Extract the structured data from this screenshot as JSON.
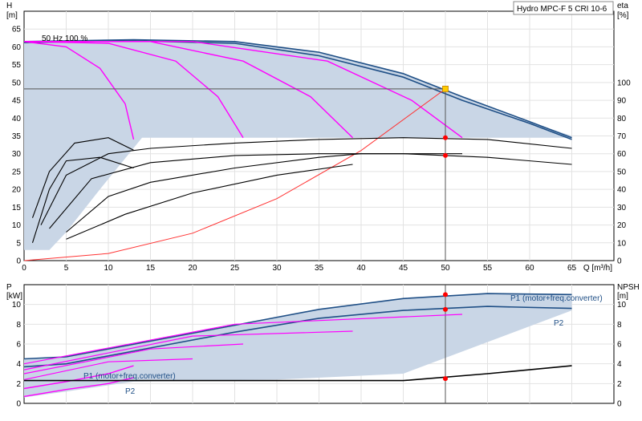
{
  "product_label": "Hydro MPC-F 5 CRI 10-6",
  "speed_label": "50 Hz 100 %",
  "colors": {
    "envelope_fill": "#c9d6e6",
    "qh_curve": "#1f4f86",
    "speed_curves": "#ff00ff",
    "efficiency": "#000000",
    "system_curve": "#ff3333",
    "duty_point": "#ff0000",
    "duty_marker": "#ffcc00",
    "label_blue": "#1f4f86"
  },
  "chart_data": [
    {
      "type": "line",
      "id": "qh",
      "xlabel": "Q [m³/h]",
      "ylabel_left": "H",
      "ylabel_left_unit": "[m]",
      "ylabel_right": "eta",
      "ylabel_right_unit": "[%]",
      "xlim": [
        0,
        70
      ],
      "ylim_left": [
        0,
        70
      ],
      "ylim_right": [
        0,
        140
      ],
      "x_ticks": [
        0,
        5,
        10,
        15,
        20,
        25,
        30,
        35,
        40,
        45,
        50,
        55,
        60,
        65
      ],
      "y_ticks_left": [
        0,
        5,
        10,
        15,
        20,
        25,
        30,
        35,
        40,
        45,
        50,
        55,
        60,
        65
      ],
      "y_ticks_right": [
        0,
        10,
        20,
        30,
        40,
        50,
        60,
        70,
        80,
        90,
        100
      ],
      "grid": true,
      "envelope": {
        "upper": [
          [
            0,
            61.5
          ],
          [
            13,
            62
          ],
          [
            25,
            61.5
          ],
          [
            35,
            58.5
          ],
          [
            45,
            52.5
          ],
          [
            52,
            46
          ],
          [
            60,
            39
          ],
          [
            65,
            35
          ]
        ],
        "lower_boundary": [
          [
            65,
            34.5
          ],
          [
            14,
            34.5
          ],
          [
            9,
            20
          ],
          [
            5,
            8
          ],
          [
            3,
            3
          ],
          [
            0,
            3
          ]
        ]
      },
      "series": [
        {
          "role": "qh-1",
          "points": [
            [
              0,
              61.5
            ],
            [
              13,
              62
            ],
            [
              25,
              61.5
            ],
            [
              35,
              58.5
            ],
            [
              45,
              52.5
            ],
            [
              52,
              46
            ],
            [
              60,
              39
            ],
            [
              65,
              34.5
            ]
          ]
        },
        {
          "role": "qh-2",
          "points": [
            [
              0,
              61.2
            ],
            [
              13,
              61.7
            ],
            [
              25,
              61
            ],
            [
              35,
              57.5
            ],
            [
              45,
              51.5
            ],
            [
              52,
              45
            ],
            [
              60,
              38.5
            ],
            [
              65,
              34
            ]
          ]
        },
        {
          "role": "speed-1",
          "points": [
            [
              0,
              61.5
            ],
            [
              5,
              60
            ],
            [
              9,
              54
            ],
            [
              12,
              44
            ],
            [
              13,
              34
            ]
          ]
        },
        {
          "role": "speed-2",
          "points": [
            [
              0,
              61.5
            ],
            [
              10,
              61
            ],
            [
              18,
              56
            ],
            [
              23,
              46
            ],
            [
              26,
              34.5
            ]
          ]
        },
        {
          "role": "speed-3",
          "points": [
            [
              0,
              61.5
            ],
            [
              15,
              61.5
            ],
            [
              26,
              56
            ],
            [
              34,
              46
            ],
            [
              39,
              34.5
            ]
          ]
        },
        {
          "role": "speed-4",
          "points": [
            [
              0,
              61.5
            ],
            [
              20,
              61.5
            ],
            [
              36,
              56
            ],
            [
              46,
              45
            ],
            [
              52,
              34.5
            ]
          ]
        },
        {
          "role": "system-curve",
          "points": [
            [
              0,
              0
            ],
            [
              10,
              2
            ],
            [
              20,
              7.7
            ],
            [
              30,
              17.4
            ],
            [
              40,
              30.9
            ],
            [
              50,
              48.2
            ]
          ]
        },
        {
          "role": "eta-1",
          "points": [
            [
              2,
              20
            ],
            [
              5,
              48
            ],
            [
              10,
              60
            ],
            [
              15,
              63
            ],
            [
              25,
              66
            ],
            [
              35,
              68
            ],
            [
              45,
              69
            ],
            [
              55,
              68
            ],
            [
              65,
              63
            ]
          ]
        },
        {
          "role": "eta-2",
          "points": [
            [
              3,
              18
            ],
            [
              8,
              46
            ],
            [
              15,
              55
            ],
            [
              25,
              59
            ],
            [
              35,
              60
            ],
            [
              45,
              60
            ],
            [
              55,
              58
            ],
            [
              65,
              54
            ]
          ]
        },
        {
          "role": "eta-3",
          "points": [
            [
              5,
              16
            ],
            [
              10,
              36
            ],
            [
              15,
              44
            ],
            [
              25,
              52
            ],
            [
              35,
              58
            ],
            [
              40,
              60
            ],
            [
              52,
              60
            ]
          ]
        },
        {
          "role": "eta-4",
          "points": [
            [
              5,
              12
            ],
            [
              12,
              26
            ],
            [
              20,
              38
            ],
            [
              30,
              48
            ],
            [
              39,
              54
            ]
          ]
        },
        {
          "role": "eta-5",
          "points": [
            [
              1,
              24
            ],
            [
              3,
              50
            ],
            [
              6,
              66
            ],
            [
              10,
              69
            ],
            [
              13,
              62
            ]
          ]
        },
        {
          "role": "eta-6",
          "points": [
            [
              1,
              10
            ],
            [
              3,
              40
            ],
            [
              5,
              56
            ],
            [
              9,
              58
            ],
            [
              13,
              52
            ]
          ]
        }
      ],
      "duty_point": {
        "x": 50,
        "h": 48.2,
        "eta_points": [
          69,
          59
        ]
      },
      "crosshair": {
        "x": 50,
        "h": 48.2
      }
    },
    {
      "type": "line",
      "id": "power",
      "xlabel": "",
      "ylabel_left": "P",
      "ylabel_left_unit": "[kW]",
      "ylabel_right": "NPSH",
      "ylabel_right_unit": "[m]",
      "xlim": [
        0,
        70
      ],
      "ylim_left": [
        0,
        12
      ],
      "ylim_right": [
        0,
        12
      ],
      "y_ticks_left": [
        0,
        2,
        4,
        6,
        8,
        10
      ],
      "y_ticks_right": [
        0,
        2,
        4,
        6,
        8,
        10
      ],
      "grid": true,
      "series": [
        {
          "role": "p1",
          "name": "P1 (motor+freq.converter)",
          "points": [
            [
              0,
              4.5
            ],
            [
              5,
              4.7
            ],
            [
              15,
              6.3
            ],
            [
              25,
              7.9
            ],
            [
              35,
              9.5
            ],
            [
              45,
              10.6
            ],
            [
              55,
              11.1
            ],
            [
              65,
              11.0
            ]
          ]
        },
        {
          "role": "p2",
          "name": "P2",
          "points": [
            [
              0,
              3.7
            ],
            [
              5,
              4
            ],
            [
              15,
              5.6
            ],
            [
              25,
              7.2
            ],
            [
              35,
              8.6
            ],
            [
              45,
              9.4
            ],
            [
              55,
              9.8
            ],
            [
              65,
              9.6
            ]
          ]
        },
        {
          "role": "p1-low",
          "name": "P1 (motor+freq.converter)",
          "points": [
            [
              0,
              1.5
            ],
            [
              5,
              2.2
            ],
            [
              10,
              3
            ],
            [
              13,
              3.8
            ]
          ]
        },
        {
          "role": "p2-low",
          "name": "P2",
          "points": [
            [
              0,
              0.7
            ],
            [
              5,
              1.4
            ],
            [
              10,
              2
            ],
            [
              13,
              2.6
            ]
          ]
        },
        {
          "role": "speed-p-1",
          "points": [
            [
              0,
              2.4
            ],
            [
              10,
              4.2
            ],
            [
              20,
              4.5
            ]
          ]
        },
        {
          "role": "speed-p-2",
          "points": [
            [
              0,
              3
            ],
            [
              15,
              5.5
            ],
            [
              26,
              6
            ]
          ]
        },
        {
          "role": "speed-p-3",
          "points": [
            [
              0,
              3.4
            ],
            [
              20,
              6.8
            ],
            [
              39,
              7.3
            ]
          ]
        },
        {
          "role": "speed-p-4",
          "points": [
            [
              0,
              4
            ],
            [
              25,
              8
            ],
            [
              52,
              9
            ]
          ]
        },
        {
          "role": "npsh",
          "points": [
            [
              0,
              2.3
            ],
            [
              45,
              2.3
            ],
            [
              55,
              3
            ],
            [
              65,
              3.8
            ]
          ]
        }
      ],
      "duty_points": [
        11.0,
        9.5,
        2.5
      ]
    }
  ]
}
